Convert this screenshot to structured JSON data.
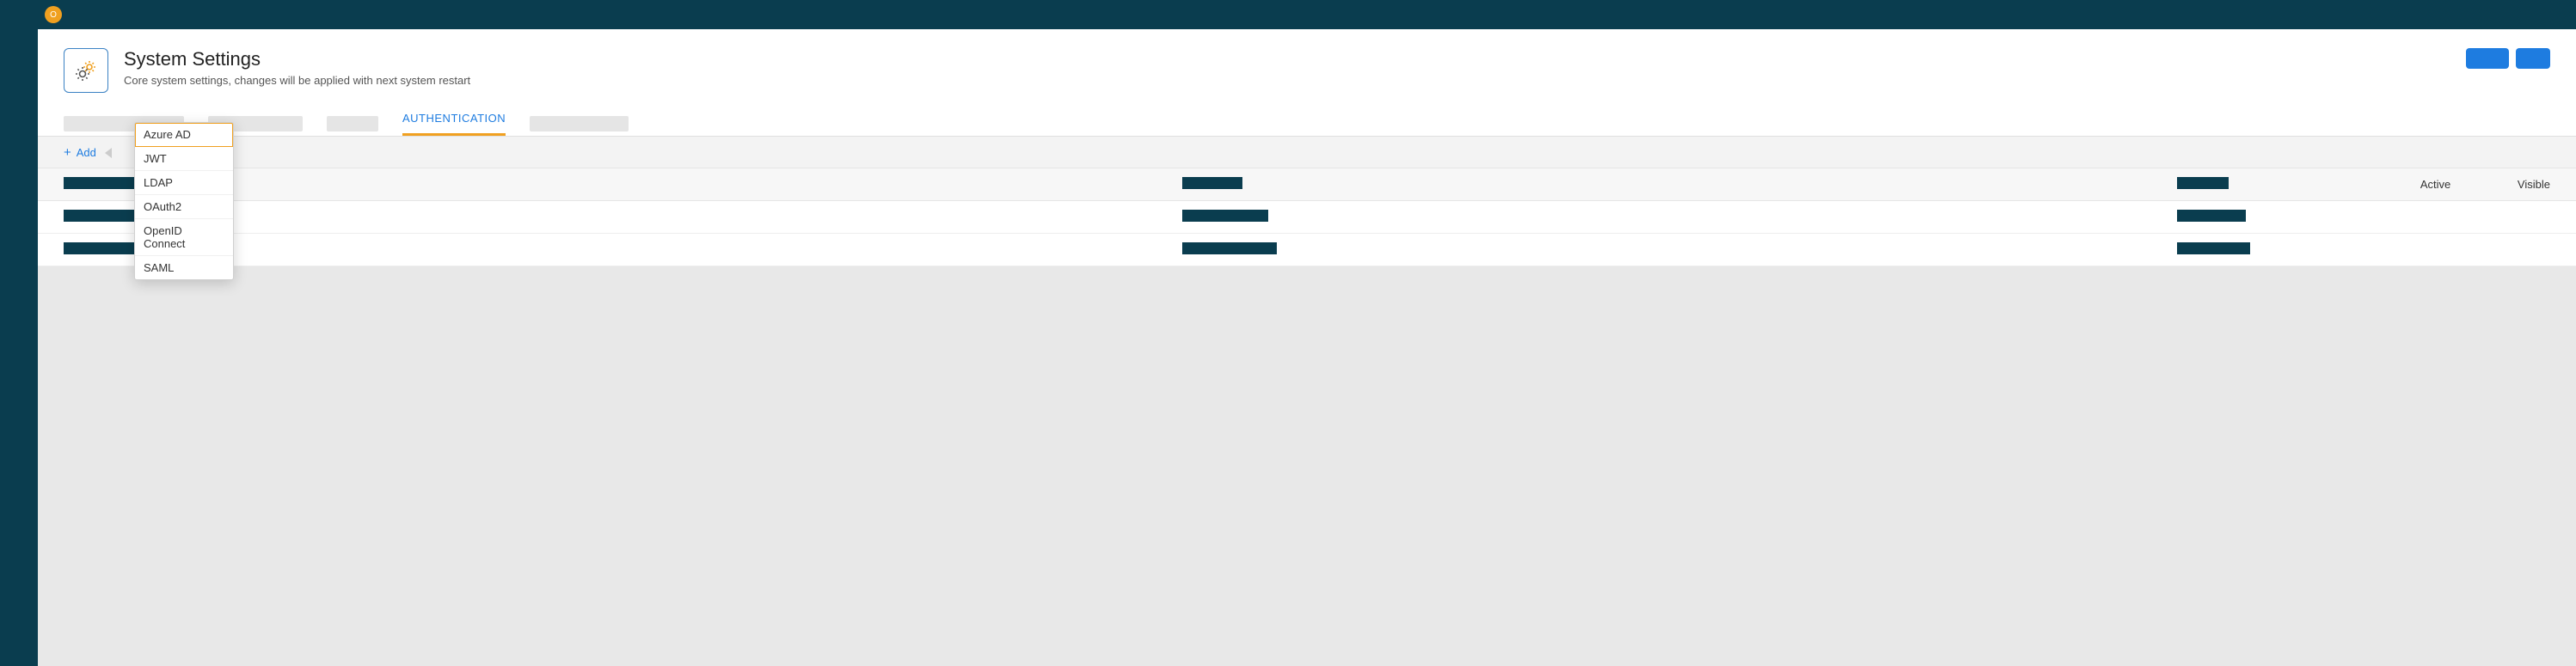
{
  "topbar": {
    "avatar_initial": "O"
  },
  "header": {
    "title": "System Settings",
    "subtitle": "Core system settings, changes will be applied with next system restart"
  },
  "tabs": {
    "active_label": "AUTHENTICATION"
  },
  "action_bar": {
    "add_label": "Add"
  },
  "dropdown": {
    "items": [
      {
        "label": "Azure AD",
        "selected": true
      },
      {
        "label": "JWT",
        "selected": false
      },
      {
        "label": "LDAP",
        "selected": false
      },
      {
        "label": "OAuth2",
        "selected": false
      },
      {
        "label": "OpenID Connect",
        "selected": false
      },
      {
        "label": "SAML",
        "selected": false
      }
    ]
  },
  "grid": {
    "header": {
      "active_label": "Active",
      "visible_label": "Visible"
    }
  }
}
